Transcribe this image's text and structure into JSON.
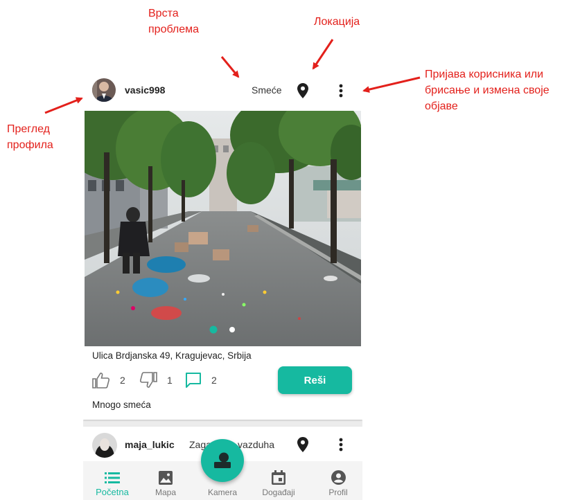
{
  "annotations": {
    "problem_type": "Врста\nпроблема",
    "location": "Локација",
    "report_or_edit": "Пријава корисника или\nбрисање и измена своје\nобјаве",
    "profile_view": "Преглед\nпрофила"
  },
  "post": {
    "username": "vasic998",
    "category": "Smeće",
    "address": "Ulica Brdjanska 49, Kragujevac, Srbija",
    "likes": "2",
    "dislikes": "1",
    "comments": "2",
    "solve_label": "Reši",
    "description": "Mnogo smeća",
    "carousel": {
      "current": 1,
      "total": 2
    }
  },
  "post2": {
    "username": "maja_lukic",
    "category": "Zagađenje vazduha"
  },
  "nav": {
    "items": [
      {
        "label": "Početna",
        "icon": "list-icon",
        "active": true
      },
      {
        "label": "Mapa",
        "icon": "image-icon",
        "active": false
      },
      {
        "label": "Kamera",
        "icon": "camera-icon",
        "active": false
      },
      {
        "label": "Događaji",
        "icon": "calendar-icon",
        "active": false
      },
      {
        "label": "Profil",
        "icon": "account-icon",
        "active": false
      }
    ]
  },
  "colors": {
    "accent": "#16b9a0",
    "annotation": "#e3201b"
  }
}
